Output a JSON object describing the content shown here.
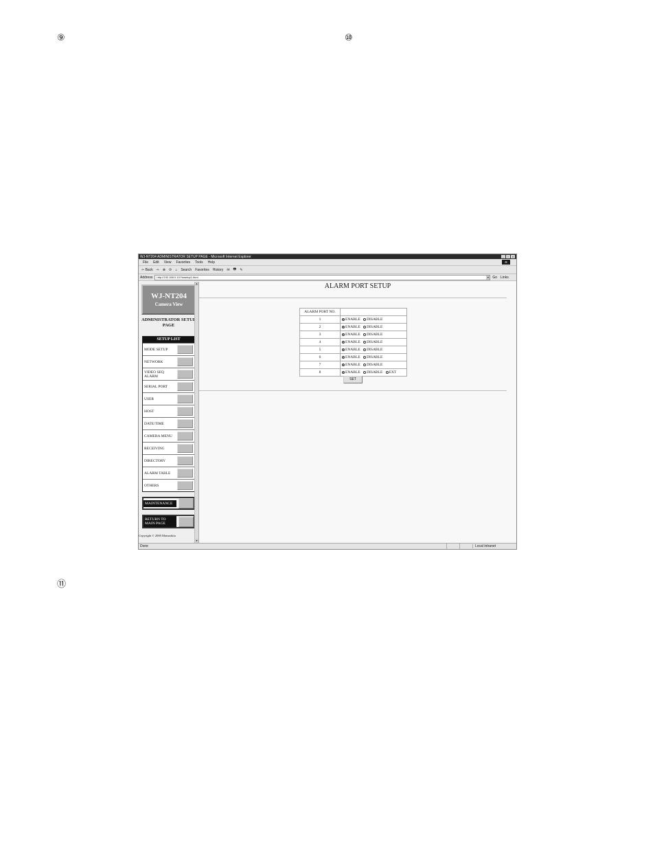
{
  "page_marks": [
    "⑨",
    "⑩",
    "⑪"
  ],
  "window": {
    "title": "WJ-NT204 ADMINISTRATOR SETUP PAGE - Microsoft Internet Explorer",
    "controls": [
      "_",
      "▫",
      "x"
    ]
  },
  "menubar": [
    "File",
    "Edit",
    "View",
    "Favorites",
    "Tools",
    "Help"
  ],
  "toolbar": [
    "⇦ Back",
    "⇨",
    "⊗",
    "⟳",
    "⌂",
    "Search",
    "Favorites",
    "History",
    "✉",
    "🖶",
    "✎"
  ],
  "address": {
    "label": "Address",
    "url": "http://192.168.0.10/?wsetup1.html",
    "go": "Go",
    "links": "Links"
  },
  "sidebar": {
    "logo_line1": "WJ-NT204",
    "logo_line2": "Camera View",
    "admin_title": "ADMINISTRATOR SETUP PAGE",
    "setup_list_header": "SETUP LIST",
    "items": [
      "MODE SETUP",
      "NETWORK",
      "VIDEO SEQ ALARM",
      "SERIAL PORT",
      "USER",
      "HOST",
      "DATE/TIME",
      "CAMERA MENU",
      "RECEIVING",
      "DIRECTORY",
      "ALARM TABLE",
      "OTHERS"
    ],
    "maintenance": "MAINTENANCE",
    "return": "RETURN TO MAIN PAGE",
    "copyright": "Copyright © 2000 Matsushita"
  },
  "main": {
    "title": "ALARM PORT SETUP",
    "table_header": "ALARM PORT NO.",
    "ports": [
      {
        "no": "1",
        "selected": "ENABLE"
      },
      {
        "no": "2",
        "selected": "ENABLE"
      },
      {
        "no": "3",
        "selected": "ENABLE"
      },
      {
        "no": "4",
        "selected": "ENABLE"
      },
      {
        "no": "5",
        "selected": "ENABLE"
      },
      {
        "no": "6",
        "selected": "ENABLE"
      },
      {
        "no": "7",
        "selected": "ENABLE"
      },
      {
        "no": "8",
        "selected": "ENABLE"
      }
    ],
    "option_enable": "ENABLE",
    "option_disable": "DISABLE",
    "option_ext": "EXT",
    "set_label": "SET"
  },
  "status": {
    "text": "Done",
    "zone": "Local intranet"
  }
}
